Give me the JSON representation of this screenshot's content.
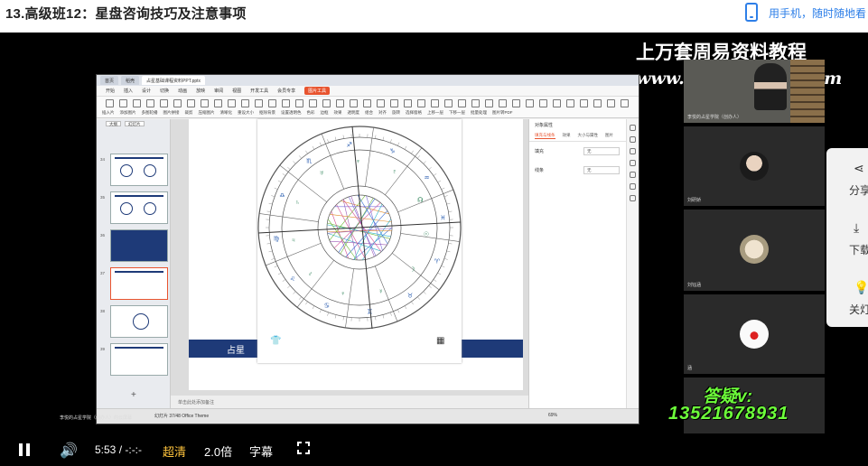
{
  "header": {
    "course_title": "13.高级班12：星盘咨询技巧及注意事项",
    "mobile_text": "用手机，随时随地看"
  },
  "watermark": {
    "line1": "上万套周易资料教程",
    "line2": "www.265zhouyiw.com"
  },
  "screen": {
    "tabs": [
      "首页",
      "稻壳",
      "占星基础课程资料PPT.pptx"
    ],
    "menu_items": [
      "开始",
      "插入",
      "设计",
      "切换",
      "动画",
      "放映",
      "审阅",
      "视图",
      "开发工具",
      "会员专享",
      "图片工具"
    ],
    "toolbar_labels": [
      "插入片",
      "添加图片",
      "多图轮播",
      "图片拼接",
      "裁剪",
      "压缩图片",
      "清晰化",
      "重设大小",
      "抠除背景",
      "设置透明色",
      "色彩",
      "边框",
      "效果",
      "透明度",
      "组合",
      "对齐",
      "旋转",
      "选择窗格",
      "上移一层",
      "下移一层",
      "批量处理",
      "图片转PDF"
    ],
    "thumb_tabs": [
      "大纲",
      "幻灯片"
    ],
    "thumb_numbers": [
      "34",
      "35",
      "36",
      "37",
      "38",
      "39"
    ],
    "slide_banner": "占星",
    "notes_text": "单击此处添加备注",
    "status_text": "幻灯片 37/48   Office Theme",
    "zoom": "69%",
    "props": {
      "title": "对象属性",
      "tabs": [
        "填充与线条",
        "效果",
        "大小与属性",
        "图片"
      ],
      "rows": [
        {
          "label": "填充",
          "value": "无"
        },
        {
          "label": "线条",
          "value": "无"
        }
      ]
    },
    "owner_tag": "李悦的占星学院（创办人）的云屏幕"
  },
  "participants": [
    {
      "name": "李悦的占星学院（创办人）"
    },
    {
      "name": "刘研娇"
    },
    {
      "name": "刘钰涵"
    },
    {
      "name": "涵"
    }
  ],
  "qa": {
    "label": "答疑v:",
    "number": "13521678931"
  },
  "side_menu": [
    {
      "label": "分享",
      "icon": "share-icon"
    },
    {
      "label": "下载",
      "icon": "download-icon"
    },
    {
      "label": "关灯",
      "icon": "lightbulb-icon"
    }
  ],
  "controls": {
    "time": "5:53  /  -:-:-",
    "quality": "超清",
    "speed": "2.0倍",
    "subtitle": "字幕"
  }
}
